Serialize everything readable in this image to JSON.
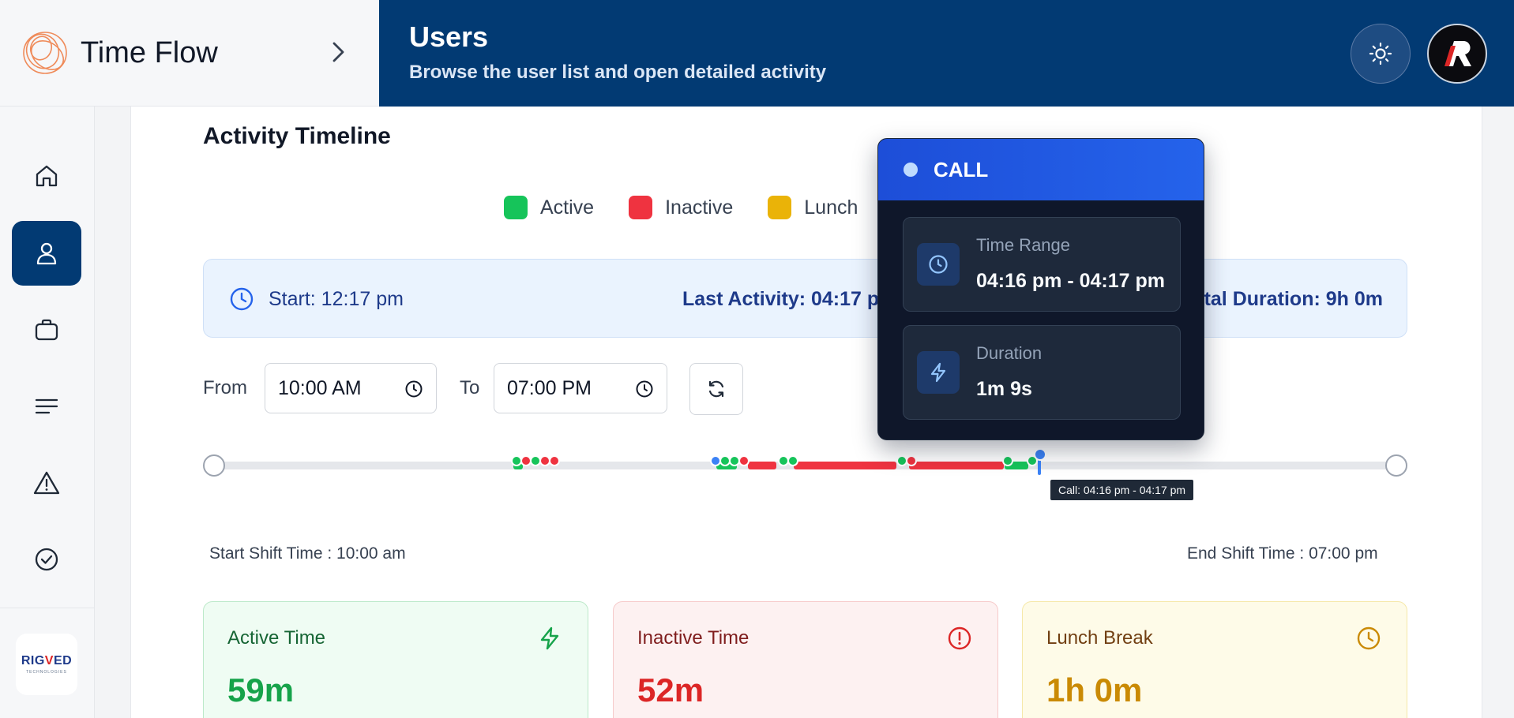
{
  "brand": {
    "name": "Time Flow"
  },
  "header": {
    "title": "Users",
    "subtitle": "Browse the user list and open detailed activity"
  },
  "sidebar": {
    "items": [
      {
        "name": "home",
        "icon": "home-icon"
      },
      {
        "name": "users",
        "icon": "user-icon",
        "active": true
      },
      {
        "name": "projects",
        "icon": "briefcase-icon"
      },
      {
        "name": "reports",
        "icon": "list-icon"
      },
      {
        "name": "alerts",
        "icon": "warning-icon"
      },
      {
        "name": "approvals",
        "icon": "check-circle-icon"
      }
    ],
    "company_logo": {
      "line1_a": "RIG",
      "line1_b": "V",
      "line1_c": "ED",
      "line2": "TECHNOLOGIES"
    }
  },
  "timeline_section": {
    "title": "Activity Timeline",
    "legend": [
      {
        "label": "Active",
        "color": "#16c45a"
      },
      {
        "label": "Inactive",
        "color": "#ef3340"
      },
      {
        "label": "Lunch",
        "color": "#eab308"
      }
    ],
    "info": {
      "start": "Start: 12:17 pm",
      "last_activity": "Last Activity: 04:17 pm",
      "total_duration": "Total Duration: 9h 0m"
    },
    "filters": {
      "from_label": "From",
      "from_value": "10:00 AM",
      "to_label": "To",
      "to_value": "07:00 PM"
    },
    "hover_tooltip": "Call: 04:16 pm - 04:17 pm",
    "shift_start": "Start Shift Time : 10:00 am",
    "shift_end": "End Shift Time : 07:00 pm"
  },
  "popover": {
    "title": "CALL",
    "time_range_label": "Time Range",
    "time_range_value": "04:16 pm - 04:17 pm",
    "duration_label": "Duration",
    "duration_value": "1m 9s"
  },
  "stats": [
    {
      "label": "Active Time",
      "value": "59m",
      "icon": "lightning-icon"
    },
    {
      "label": "Inactive Time",
      "value": "52m",
      "icon": "alert-circle-icon"
    },
    {
      "label": "Lunch Break",
      "value": "1h 0m",
      "icon": "clock-icon"
    }
  ],
  "colors": {
    "header_bg": "#023a73",
    "active": "#16c45a",
    "inactive": "#ef3340",
    "lunch": "#eab308",
    "call": "#3b82f6"
  }
}
